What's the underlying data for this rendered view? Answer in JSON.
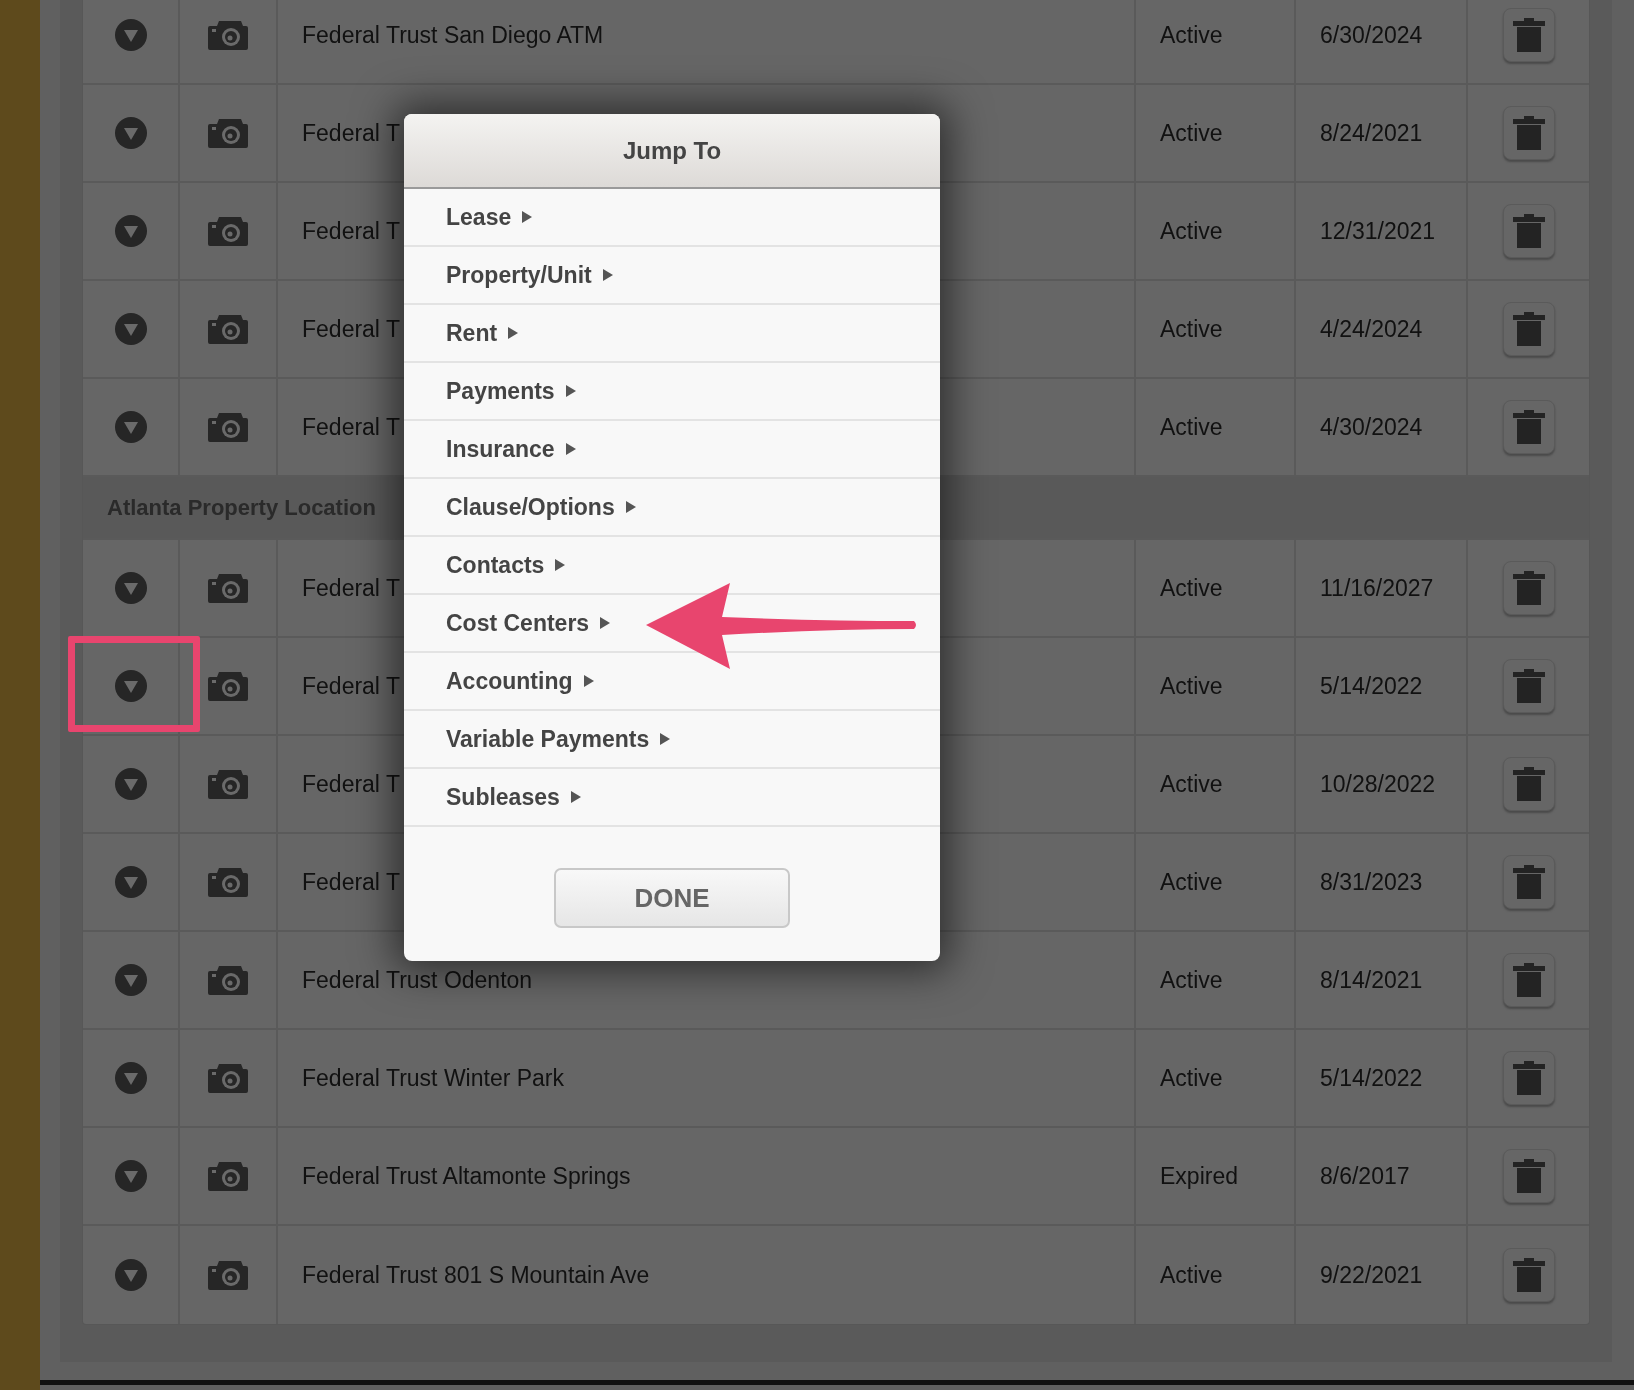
{
  "table": {
    "rows": [
      {
        "kind": "row",
        "name": "Federal Trust San Diego ATM",
        "status": "Active",
        "date": "6/30/2024"
      },
      {
        "kind": "row",
        "name": "Federal T",
        "status": "Active",
        "date": "8/24/2021"
      },
      {
        "kind": "row",
        "name": "Federal T",
        "status": "Active",
        "date": "12/31/2021"
      },
      {
        "kind": "row",
        "name": "Federal T",
        "status": "Active",
        "date": "4/24/2024"
      },
      {
        "kind": "row",
        "name": "Federal T",
        "status": "Active",
        "date": "4/30/2024"
      },
      {
        "kind": "group",
        "title": "Atlanta Property Location"
      },
      {
        "kind": "row",
        "name": "Federal T",
        "status": "Active",
        "date": "11/16/2027"
      },
      {
        "kind": "row",
        "name": "Federal T",
        "status": "Active",
        "date": "5/14/2022"
      },
      {
        "kind": "row",
        "name": "Federal T",
        "status": "Active",
        "date": "10/28/2022"
      },
      {
        "kind": "row",
        "name": "Federal T",
        "status": "Active",
        "date": "8/31/2023"
      },
      {
        "kind": "row",
        "name": "Federal Trust Odenton",
        "status": "Active",
        "date": "8/14/2021"
      },
      {
        "kind": "row",
        "name": "Federal Trust Winter Park",
        "status": "Active",
        "date": "5/14/2022"
      },
      {
        "kind": "row",
        "name": "Federal Trust Altamonte Springs",
        "status": "Expired",
        "date": "8/6/2017"
      },
      {
        "kind": "row",
        "name": "Federal Trust 801 S Mountain Ave",
        "status": "Active",
        "date": "9/22/2021"
      }
    ]
  },
  "jump_to": {
    "title": "Jump To",
    "items": [
      "Lease",
      "Property/Unit",
      "Rent",
      "Payments",
      "Insurance",
      "Clause/Options",
      "Contacts",
      "Cost Centers",
      "Accounting",
      "Variable Payments",
      "Subleases"
    ],
    "button": "DONE"
  }
}
